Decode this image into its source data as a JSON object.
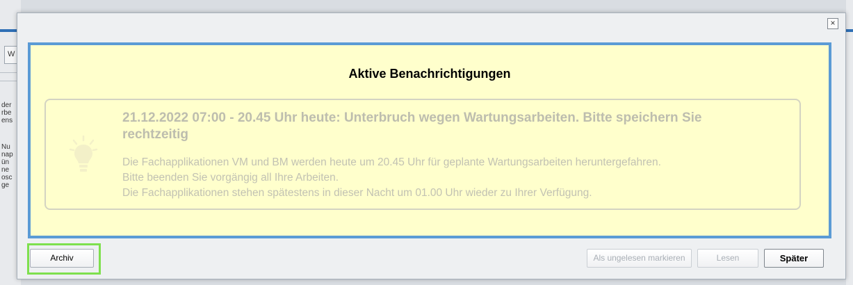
{
  "background_app": {
    "tab_label": "W",
    "text_lines_a": [
      "der",
      "rbe",
      "ens"
    ],
    "text_lines_b": [
      "Nu",
      "nap",
      "ün",
      "ne",
      "osc",
      "ge"
    ]
  },
  "dialog": {
    "close_symbol": "×",
    "title": "Aktive Benachrichtigungen",
    "notification": {
      "icon": "lightbulb-icon",
      "title": "21.12.2022 07:00 - 20.45 Uhr heute: Unterbruch wegen Wartungsarbeiten. Bitte speichern Sie rechtzeitig",
      "body_lines": [
        "Die Fachapplikationen VM und BM werden heute um 20.45 Uhr für geplante Wartungsarbeiten heruntergefahren.",
        "Bitte beenden Sie vorgängig all Ihre Arbeiten.",
        "Die Fachapplikationen stehen spätestens in dieser Nacht um 01.00 Uhr wieder zu Ihrer Verfügung."
      ]
    },
    "buttons": {
      "archive": "Archiv",
      "mark_unread": "Als ungelesen markieren",
      "read": "Lesen",
      "later": "Später"
    }
  },
  "colors": {
    "panel_background": "#ffffcc",
    "panel_border": "#5b9bd5",
    "focus_highlight": "#7ee04e"
  }
}
